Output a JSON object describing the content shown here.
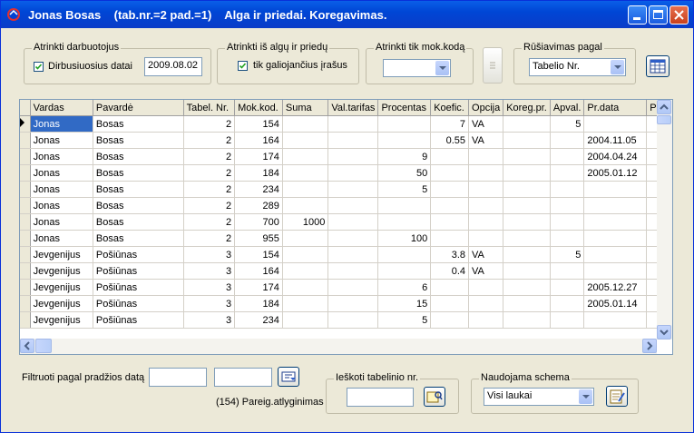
{
  "window": {
    "title": "Jonas Bosas    (tab.nr.=2 pad.=1)    Alga ir priedai. Koregavimas."
  },
  "filters": {
    "employee_group": {
      "legend": "Atrinkti darbuotojus",
      "checkbox_label": "Dirbusiuosius datai",
      "checked": true,
      "date": "2009.08.02"
    },
    "salary_group": {
      "legend": "Atrinkti iš algų ir priedų",
      "checkbox_label": "tik galiojančius įrašus",
      "checked": true
    },
    "code_group": {
      "legend": "Atrinkti tik mok.kodą",
      "selected": ""
    },
    "sort_group": {
      "legend": "Rūšiavimas pagal",
      "selected": "Tabelio Nr."
    }
  },
  "grid": {
    "columns": [
      "Vardas",
      "Pavardė",
      "Tabel. Nr.",
      "Mok.kod.",
      "Suma",
      "Val.tarifas",
      "Procentas",
      "Koefic.",
      "Opcija",
      "Koreg.pr.",
      "Apval.",
      "Pr.data",
      "P"
    ],
    "rows": [
      [
        "Jonas",
        "Bosas",
        "2",
        "154",
        "",
        "",
        "",
        "7",
        "VA",
        "",
        "5",
        "",
        ""
      ],
      [
        "Jonas",
        "Bosas",
        "2",
        "164",
        "",
        "",
        "",
        "0.55",
        "VA",
        "",
        "",
        "2004.11.05",
        ""
      ],
      [
        "Jonas",
        "Bosas",
        "2",
        "174",
        "",
        "",
        "9",
        "",
        "",
        "",
        "",
        "2004.04.24",
        ""
      ],
      [
        "Jonas",
        "Bosas",
        "2",
        "184",
        "",
        "",
        "50",
        "",
        "",
        "",
        "",
        "2005.01.12",
        ""
      ],
      [
        "Jonas",
        "Bosas",
        "2",
        "234",
        "",
        "",
        "5",
        "",
        "",
        "",
        "",
        "",
        ""
      ],
      [
        "Jonas",
        "Bosas",
        "2",
        "289",
        "",
        "",
        "",
        "",
        "",
        "",
        "",
        "",
        ""
      ],
      [
        "Jonas",
        "Bosas",
        "2",
        "700",
        "1000",
        "",
        "",
        "",
        "",
        "",
        "",
        "",
        ""
      ],
      [
        "Jonas",
        "Bosas",
        "2",
        "955",
        "",
        "",
        "100",
        "",
        "",
        "",
        "",
        "",
        ""
      ],
      [
        "Jevgenijus",
        "Pošiūnas",
        "3",
        "154",
        "",
        "",
        "",
        "3.8",
        "VA",
        "",
        "5",
        "",
        ""
      ],
      [
        "Jevgenijus",
        "Pošiūnas",
        "3",
        "164",
        "",
        "",
        "",
        "0.4",
        "VA",
        "",
        "",
        "",
        ""
      ],
      [
        "Jevgenijus",
        "Pošiūnas",
        "3",
        "174",
        "",
        "",
        "6",
        "",
        "",
        "",
        "",
        "2005.12.27",
        ""
      ],
      [
        "Jevgenijus",
        "Pošiūnas",
        "3",
        "184",
        "",
        "",
        "15",
        "",
        "",
        "",
        "",
        "2005.01.14",
        ""
      ],
      [
        "Jevgenijus",
        "Pošiūnas",
        "3",
        "234",
        "",
        "",
        "5",
        "",
        "",
        "",
        "",
        "",
        ""
      ]
    ]
  },
  "bottom": {
    "filter_label": "Filtruoti pagal pradžios datą",
    "date_from": "",
    "date_to": "",
    "status_text": "(154) Pareig.atlyginimas",
    "search_legend": "Ieškoti tabelinio nr.",
    "search_value": "",
    "schema_legend": "Naudojama schema",
    "schema_selected": "Visi laukai"
  }
}
